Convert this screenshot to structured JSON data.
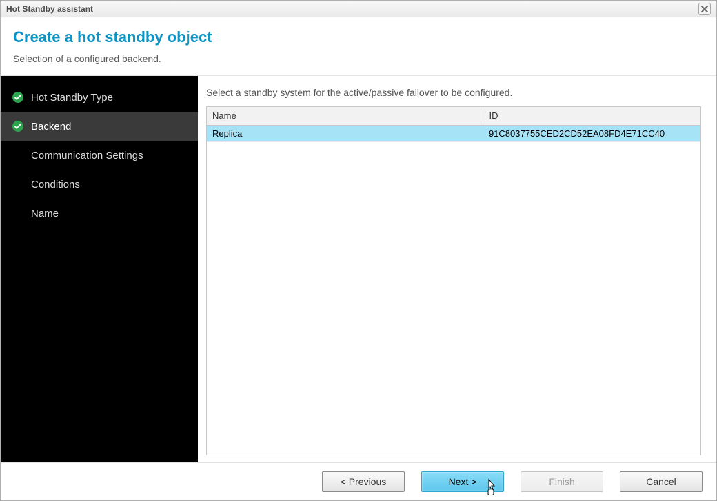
{
  "window": {
    "title": "Hot Standby assistant"
  },
  "header": {
    "title": "Create a hot standby object",
    "subtitle": "Selection of a configured backend."
  },
  "sidebar": {
    "items": [
      {
        "label": "Hot Standby Type",
        "done": true,
        "active": false
      },
      {
        "label": "Backend",
        "done": true,
        "active": true
      },
      {
        "label": "Communication Settings",
        "done": false,
        "active": false
      },
      {
        "label": "Conditions",
        "done": false,
        "active": false
      },
      {
        "label": "Name",
        "done": false,
        "active": false
      }
    ]
  },
  "content": {
    "instructions": "Select a standby system for the active/passive failover to be configured.",
    "table": {
      "columns": [
        "Name",
        "ID"
      ],
      "rows": [
        {
          "selected": true,
          "cells": [
            "Replica",
            "91C8037755CED2CD52EA08FD4E71CC40"
          ]
        }
      ]
    }
  },
  "footer": {
    "previous": "< Previous",
    "next": "Next >",
    "finish": "Finish",
    "cancel": "Cancel"
  }
}
